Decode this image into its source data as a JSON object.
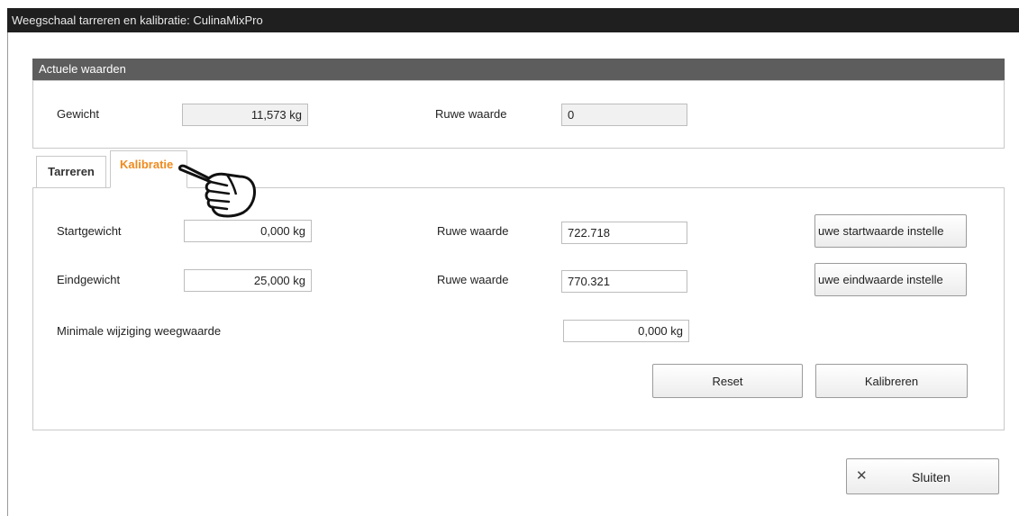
{
  "window": {
    "title": "Weegschaal tarreren en kalibratie: CulinaMixPro"
  },
  "current_values": {
    "header": "Actuele waarden",
    "weight_label": "Gewicht",
    "weight_value": "11,573 kg",
    "raw_label": "Ruwe waarde",
    "raw_value": "0"
  },
  "tabs": [
    {
      "label": "Tarreren",
      "active": false
    },
    {
      "label": "Kalibratie",
      "active": true
    }
  ],
  "calibration": {
    "start_label": "Startgewicht",
    "start_value": "0,000 kg",
    "start_raw_label": "Ruwe waarde",
    "start_raw_value": "722.718",
    "start_button": "uwe startwaarde instelle",
    "end_label": "Eindgewicht",
    "end_value": "25,000 kg",
    "end_raw_label": "Ruwe waarde",
    "end_raw_value": "770.321",
    "end_button": "uwe eindwaarde instelle",
    "min_change_label": "Minimale wijziging weegwaarde",
    "min_change_value": "0,000 kg",
    "reset_button": "Reset",
    "calibrate_button": "Kalibreren"
  },
  "footer": {
    "close_button": "Sluiten",
    "close_icon": "close-icon"
  },
  "colors": {
    "active_tab": "#f08a1d",
    "titlebar": "#1f1f1f",
    "section_header": "#5d5d5d"
  }
}
